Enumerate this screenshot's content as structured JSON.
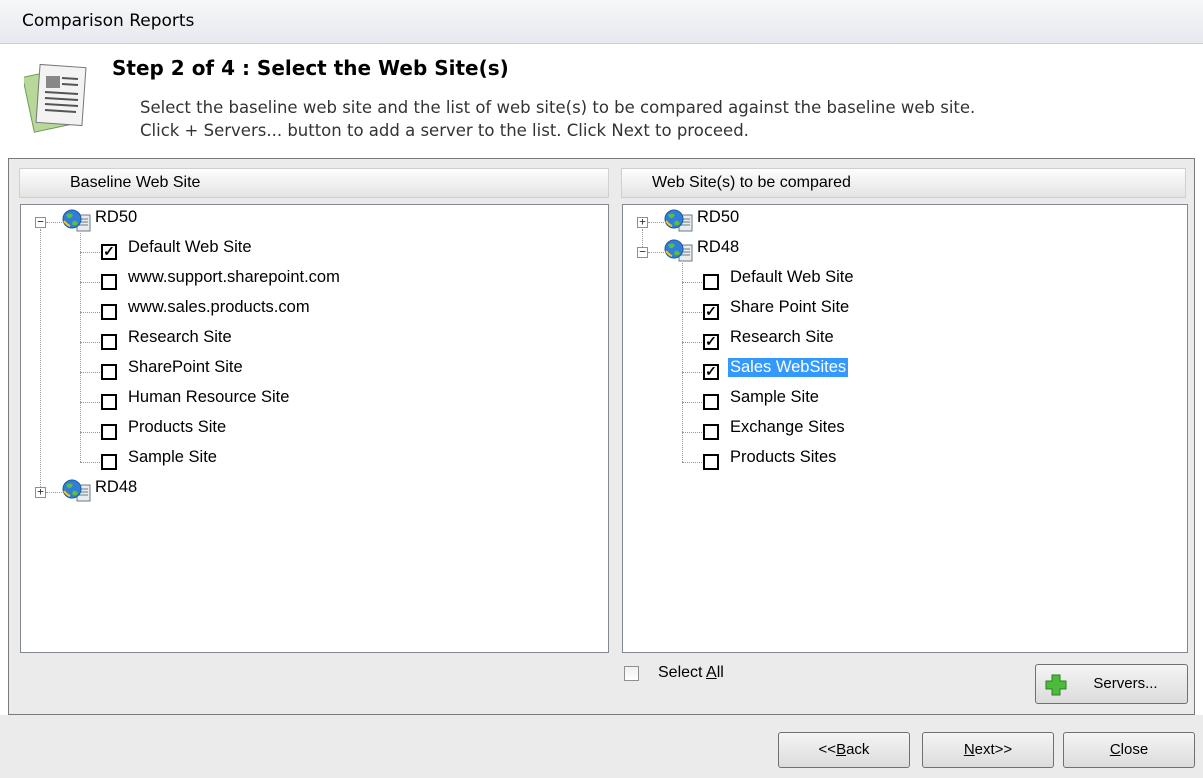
{
  "window": {
    "title": "Comparison Reports"
  },
  "header": {
    "step_title": "Step 2 of 4 : Select the Web Site(s)",
    "description_line1": "Select the baseline web site and the list of web site(s) to be compared against the baseline web site.",
    "description_line2": "Click + Servers... button to add a server to the list. Click Next to proceed."
  },
  "left_pane": {
    "header": "Baseline Web Site",
    "servers": [
      {
        "name": "RD50",
        "expanded": true,
        "sites": [
          {
            "label": "Default Web Site",
            "checked": true
          },
          {
            "label": "www.support.sharepoint.com",
            "checked": false
          },
          {
            "label": "www.sales.products.com",
            "checked": false
          },
          {
            "label": "Research Site",
            "checked": false
          },
          {
            "label": "SharePoint Site",
            "checked": false
          },
          {
            "label": "Human Resource Site",
            "checked": false
          },
          {
            "label": "Products Site",
            "checked": false
          },
          {
            "label": "Sample Site",
            "checked": false
          }
        ]
      },
      {
        "name": "RD48",
        "expanded": false,
        "sites": []
      }
    ]
  },
  "right_pane": {
    "header": "Web Site(s) to be compared",
    "servers": [
      {
        "name": "RD50",
        "expanded": false,
        "sites": []
      },
      {
        "name": "RD48",
        "expanded": true,
        "sites": [
          {
            "label": "Default Web Site",
            "checked": false
          },
          {
            "label": "Share Point Site",
            "checked": true
          },
          {
            "label": "Research Site",
            "checked": true
          },
          {
            "label": "Sales WebSites",
            "checked": true,
            "selected": true
          },
          {
            "label": "Sample Site",
            "checked": false
          },
          {
            "label": "Exchange Sites",
            "checked": false
          },
          {
            "label": "Products Sites",
            "checked": false
          }
        ]
      }
    ]
  },
  "select_all": {
    "label_pre": "Select ",
    "label_mnemonic": "A",
    "label_post": "ll",
    "checked": false
  },
  "buttons": {
    "servers": "Servers...",
    "back_pre": "<<",
    "back_mnemonic": "B",
    "back_post": "ack",
    "next_mnemonic": "N",
    "next_post": "ext>>",
    "close_mnemonic": "C",
    "close_post": "lose"
  },
  "colors": {
    "selection": "#3399ff",
    "dialog_bg": "#ebebeb"
  }
}
